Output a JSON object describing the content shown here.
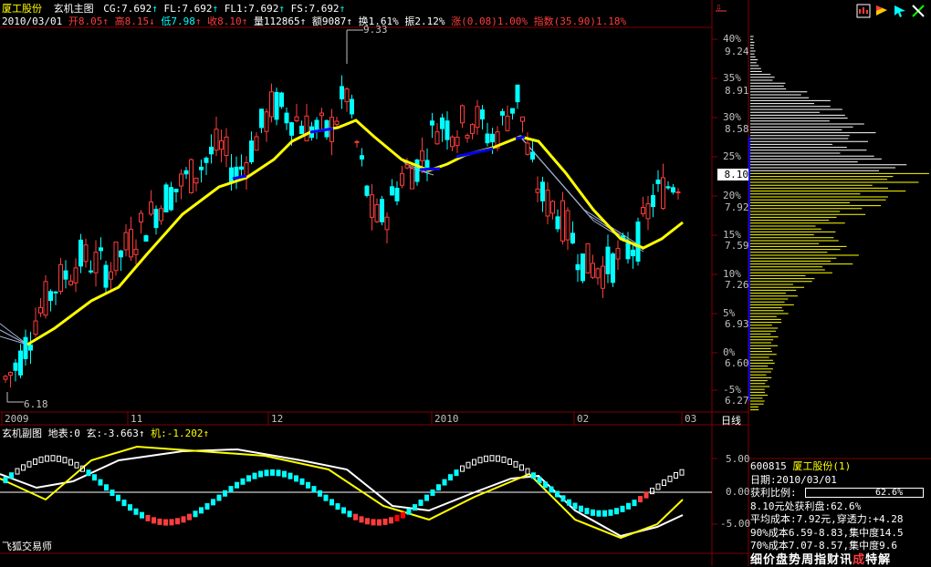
{
  "main": {
    "stock_name": "厦工股份",
    "chart_title": "玄机主图",
    "indicators": [
      {
        "label": "CG:7.692",
        "color": "#ffffff"
      },
      {
        "label": "FL:7.692",
        "color": "#ffffff"
      },
      {
        "label": "FL1:7.692",
        "color": "#ffffff"
      },
      {
        "label": "FS:7.692",
        "color": "#ffffff"
      }
    ],
    "quote": {
      "date": "2010/03/01",
      "open": "开8.05",
      "high": "高8.15",
      "low": "低7.98",
      "close": "收8.10",
      "volume": "量112865",
      "amount": "额9087",
      "turnover": "换1.61%",
      "amplitude": "振2.12%",
      "change": "涨(0.08)1.00%",
      "index": "指数(35.90)1.18%"
    },
    "high_marker": "9.33",
    "low_marker": "6.18",
    "price_axis": [
      "9.24",
      "8.91",
      "8.58",
      "8.25",
      "7.92",
      "7.59",
      "7.26",
      "6.93",
      "6.60",
      "6.27"
    ],
    "pct_axis": [
      "40%",
      "35%",
      "30%",
      "25%",
      "20%",
      "15%",
      "10%",
      "5%",
      "0%",
      "-5%"
    ],
    "current_price": "8.10",
    "date_axis": [
      "2009",
      "11",
      "12",
      "2010",
      "02",
      "03"
    ],
    "period_label": "日线"
  },
  "sub": {
    "title": "玄机副图",
    "ground": "地表:0",
    "xuan": "玄:-3.663",
    "ji": "机:-1.202",
    "axis": [
      "5.00",
      "0.00",
      "-5.00"
    ],
    "watermark": "飞狐交易师"
  },
  "panel": {
    "code": "600815",
    "name": "厦工股份(1)",
    "date_label": "日期:2010/03/01",
    "profit_label": "获利比例:",
    "profit_value": "62.6%",
    "profit_fraction": 0.626,
    "line1": "8.10元处获利盘:62.6%",
    "line2": "平均成本:7.92元,穿透力:+4.28",
    "line3": "90%成本6.59-8.83,集中度14.5",
    "line4": "70%成本7.07-8.57,集中度9.6"
  },
  "banner": {
    "chars": [
      "细",
      "价",
      "盘",
      "势",
      "周",
      "指",
      "财",
      "讯",
      "成",
      "特",
      "解"
    ],
    "highlight_index": 8
  },
  "toolbar": {
    "colors": {
      "up": "#ff3c3c",
      "down": "#00ffff",
      "ma": "#ffff00",
      "grid": "#800000"
    }
  }
}
